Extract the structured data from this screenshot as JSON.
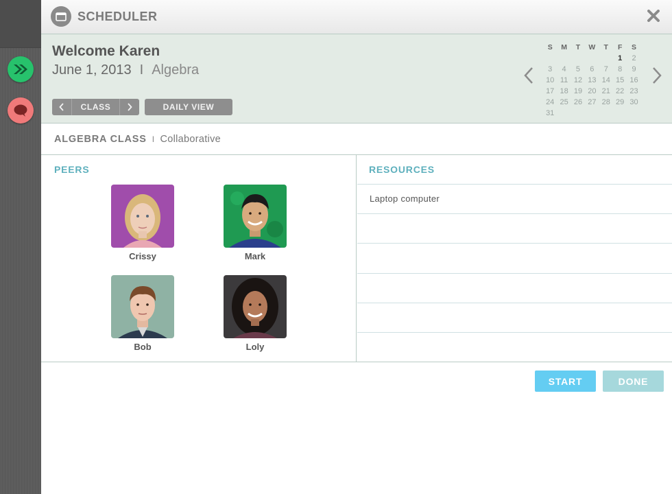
{
  "app": {
    "title": "SCHEDULER"
  },
  "rail": {
    "icons": [
      "calendar-icon",
      "fast-forward-icon",
      "chat-icon"
    ]
  },
  "welcome": {
    "greeting": "Welcome Karen",
    "date": "June 1, 2013",
    "separator": "I",
    "subject": "Algebra"
  },
  "toolbar": {
    "class_label": "CLASS",
    "daily_view_label": "DAILY VIEW"
  },
  "calendar": {
    "weekdays": [
      "S",
      "M",
      "T",
      "W",
      "T",
      "F",
      "S"
    ],
    "weeks": [
      [
        "",
        "",
        "",
        "",
        "",
        "1",
        "2"
      ],
      [
        "3",
        "4",
        "5",
        "6",
        "7",
        "8",
        "9"
      ],
      [
        "10",
        "11",
        "12",
        "13",
        "14",
        "15",
        "16"
      ],
      [
        "17",
        "18",
        "19",
        "20",
        "21",
        "22",
        "23"
      ],
      [
        "24",
        "25",
        "26",
        "27",
        "28",
        "29",
        "30"
      ],
      [
        "31",
        "",
        "",
        "",
        "",
        "",
        ""
      ]
    ],
    "today": "1"
  },
  "class_info": {
    "name": "ALGEBRA CLASS",
    "separator": "I",
    "type": "Collaborative"
  },
  "peers": {
    "title": "PEERS",
    "items": [
      {
        "name": "Crissy"
      },
      {
        "name": "Mark"
      },
      {
        "name": "Bob"
      },
      {
        "name": "Loly"
      }
    ]
  },
  "resources": {
    "title": "RESOURCES",
    "items": [
      "Laptop computer",
      "",
      "",
      "",
      "",
      ""
    ]
  },
  "actions": {
    "start_label": "START",
    "done_label": "DONE"
  },
  "colors": {
    "accent_blue": "#64cdf2",
    "done_teal": "#a6d8dc",
    "section_title": "#5eb0bd",
    "band_bg": "#e3ebe5"
  }
}
